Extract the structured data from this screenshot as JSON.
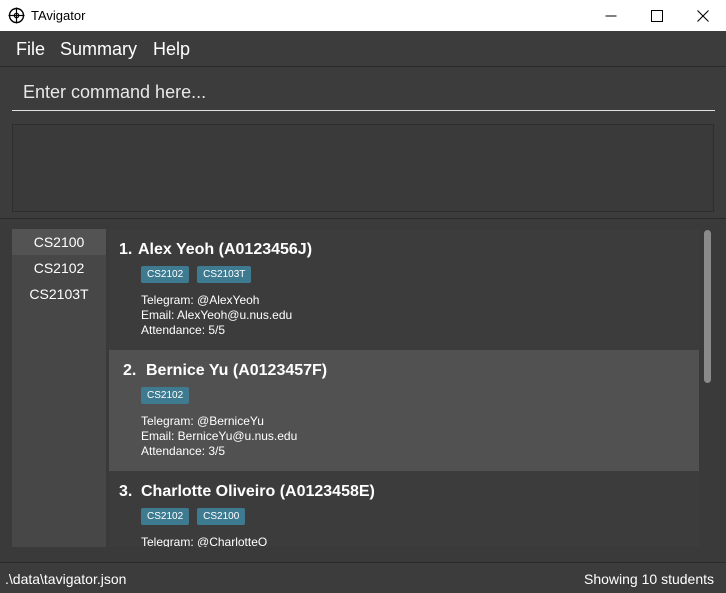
{
  "window": {
    "title": "TAvigator",
    "icon": "helm-icon"
  },
  "menu": {
    "items": [
      "File",
      "Summary",
      "Help"
    ]
  },
  "command": {
    "placeholder": "Enter command here..."
  },
  "modules": [
    "CS2100",
    "CS2102",
    "CS2103T"
  ],
  "students": [
    {
      "index": "1.",
      "name": "Alex Yeoh (A0123456J)",
      "tags": [
        "CS2102",
        "CS2103T"
      ],
      "telegram": "Telegram: @AlexYeoh",
      "email": "Email: AlexYeoh@u.nus.edu",
      "attendance": "Attendance: 5/5"
    },
    {
      "index": "2.",
      "name": "Bernice Yu (A0123457F)",
      "tags": [
        "CS2102"
      ],
      "telegram": "Telegram: @BerniceYu",
      "email": "Email: BerniceYu@u.nus.edu",
      "attendance": "Attendance: 3/5"
    },
    {
      "index": "3.",
      "name": "Charlotte Oliveiro (A0123458E)",
      "tags": [
        "CS2102",
        "CS2100"
      ],
      "telegram": "Telegram: @CharlotteO",
      "email": "",
      "attendance": ""
    }
  ],
  "status": {
    "file_path": ".\\data\\tavigator.json",
    "summary": "Showing 10 students"
  },
  "colors": {
    "background": "#3c3c3c",
    "tag": "#3e7b91",
    "selected_card": "#515151"
  }
}
